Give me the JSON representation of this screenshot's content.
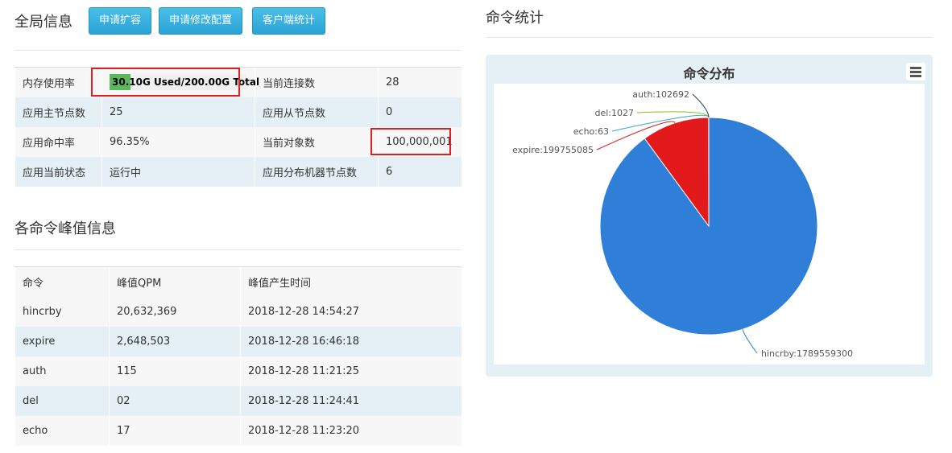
{
  "global": {
    "title": "全局信息",
    "buttons": [
      "申请扩容",
      "申请修改配置",
      "客户端统计"
    ]
  },
  "info": {
    "rows": [
      {
        "k1": "内存使用率",
        "mem": {
          "used": "30.10G",
          "total": "200.00G",
          "text": "30.10G  Used/200.00G  Total",
          "fraction": 0.1505
        },
        "k2": "当前连接数",
        "v2": "28"
      },
      {
        "k1": "应用主节点数",
        "v1": "25",
        "k2": "应用从节点数",
        "v2": "0"
      },
      {
        "k1": "应用命中率",
        "v1": "96.35%",
        "k2": "当前对象数",
        "v2": "100,000,001"
      },
      {
        "k1": "应用当前状态",
        "v1": "运行中",
        "k2": "应用分布机器节点数",
        "v2": "6"
      }
    ]
  },
  "peak": {
    "title": "各命令峰值信息",
    "headers": [
      "命令",
      "峰值QPM",
      "峰值产生时间"
    ],
    "rows": [
      [
        "hincrby",
        "20,632,369",
        "2018-12-28 14:54:27"
      ],
      [
        "expire",
        "2,648,503",
        "2018-12-28 16:46:18"
      ],
      [
        "auth",
        "115",
        "2018-12-28 11:21:25"
      ],
      [
        "del",
        "02",
        "2018-12-28 11:24:41"
      ],
      [
        "echo",
        "17",
        "2018-12-28 11:23:20"
      ]
    ]
  },
  "commands": {
    "title": "命令统计"
  },
  "chart_data": {
    "type": "pie",
    "title": "命令分布",
    "slices": [
      {
        "name": "hincrby",
        "value": 1789559300,
        "color": "#2f7ed8"
      },
      {
        "name": "expire",
        "value": 199755085,
        "color": "#e31a1c"
      },
      {
        "name": "echo",
        "value": 63,
        "color": "#3aa6c8"
      },
      {
        "name": "del",
        "value": 1027,
        "color": "#8bbc21"
      },
      {
        "name": "auth",
        "value": 102692,
        "color": "#1a3b5c"
      }
    ],
    "labels": [
      "hincrby:1789559300",
      "expire:199755085",
      "echo:63",
      "del:1027",
      "auth:102692"
    ]
  }
}
